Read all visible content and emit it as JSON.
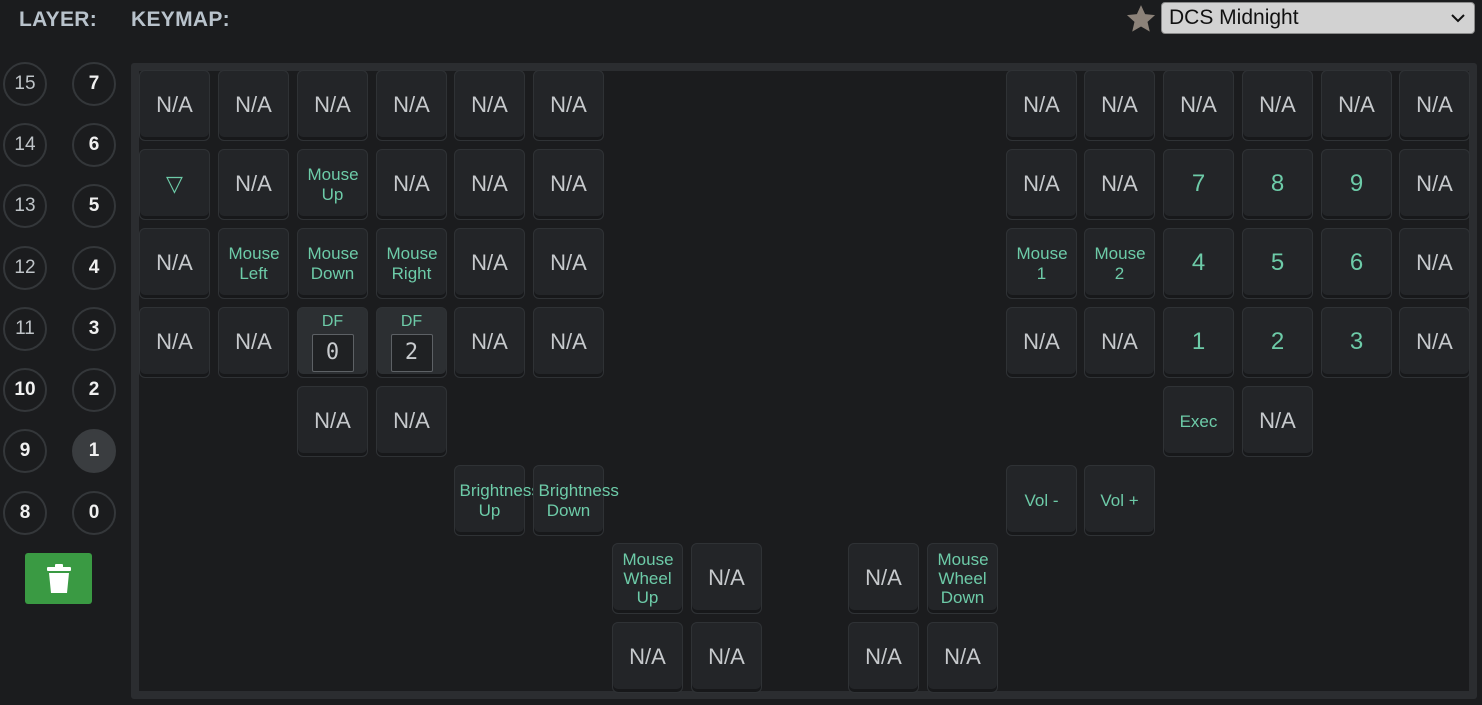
{
  "header": {
    "layer_label": "LAYER:",
    "keymap_label": "KEYMAP:"
  },
  "keymap_select": {
    "selected": "DCS Midnight"
  },
  "favorite_icon": "star-icon",
  "layers": [
    "15",
    "7",
    "14",
    "6",
    "13",
    "5",
    "12",
    "4",
    "11",
    "3",
    "10",
    "2",
    "9",
    "1",
    "8",
    "0"
  ],
  "selected_layer": "1",
  "delete_icon": "trash-icon",
  "colors": {
    "accent": "#6dcba8",
    "delete": "#3a9a43"
  },
  "left_half": {
    "r1": [
      "N/A",
      "N/A",
      "N/A",
      "N/A",
      "N/A",
      "N/A"
    ],
    "r2": [
      "▽",
      "N/A",
      "Mouse Up",
      "N/A",
      "N/A",
      "N/A"
    ],
    "r3": [
      "N/A",
      "Mouse Left",
      "Mouse Down",
      "Mouse Right",
      "N/A",
      "N/A"
    ],
    "r4": [
      "N/A",
      "N/A",
      "DF",
      "DF",
      "N/A",
      "N/A"
    ],
    "r4_df_values": [
      "0",
      "2"
    ],
    "r5": [
      "N/A",
      "N/A"
    ],
    "r6": [
      "Brightness Up",
      "Brightness Down"
    ],
    "thumb1": [
      "Mouse Wheel Up",
      "N/A"
    ],
    "thumb2": [
      "N/A",
      "N/A"
    ]
  },
  "right_half": {
    "r1": [
      "N/A",
      "N/A",
      "N/A",
      "N/A",
      "N/A",
      "N/A"
    ],
    "r2": [
      "N/A",
      "N/A",
      "7",
      "8",
      "9",
      "N/A"
    ],
    "r3": [
      "Mouse 1",
      "Mouse 2",
      "4",
      "5",
      "6",
      "N/A"
    ],
    "r4": [
      "N/A",
      "N/A",
      "1",
      "2",
      "3",
      "N/A"
    ],
    "r5": [
      "Exec",
      "N/A"
    ],
    "r6": [
      "Vol -",
      "Vol +"
    ],
    "thumb1": [
      "N/A",
      "Mouse Wheel Down"
    ],
    "thumb2": [
      "N/A",
      "N/A"
    ]
  }
}
